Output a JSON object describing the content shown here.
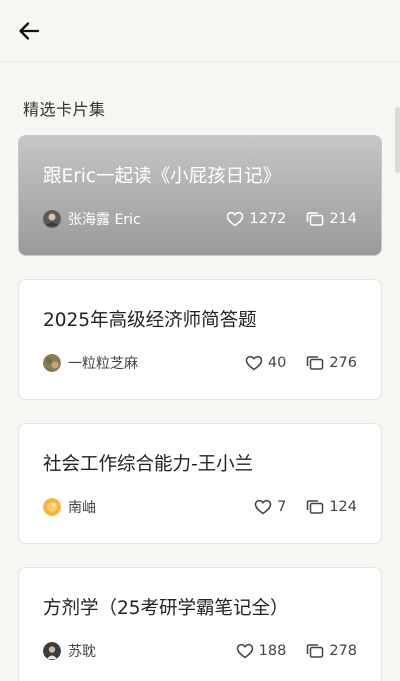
{
  "header": {
    "back_icon": "arrow-left-icon"
  },
  "section": {
    "title": "精选卡片集"
  },
  "cards": [
    {
      "title": "跟Eric一起读《小屁孩日记》",
      "author": "张海露 Eric",
      "likes": "1272",
      "cards_count": "214",
      "featured": true,
      "avatar_color": "#6b6b6b"
    },
    {
      "title": "2025年高级经济师简答题",
      "author": "一粒粒芝麻",
      "likes": "40",
      "cards_count": "276",
      "featured": false,
      "avatar_color": "#7a8a5e"
    },
    {
      "title": "社会工作综合能力-王小兰",
      "author": "南岫",
      "likes": "7",
      "cards_count": "124",
      "featured": false,
      "avatar_color": "#f0b43a"
    },
    {
      "title": "方剂学（25考研学霸笔记全）",
      "author": "苏耽",
      "likes": "188",
      "cards_count": "278",
      "featured": false,
      "avatar_color": "#4a4a4a"
    }
  ]
}
